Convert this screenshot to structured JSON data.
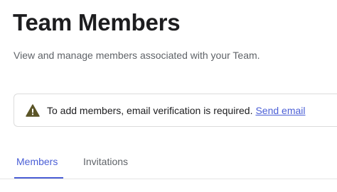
{
  "header": {
    "title": "Team Members",
    "subtitle": "View and manage members associated with your Team."
  },
  "alert": {
    "icon": "warning-icon",
    "message": "To add members, email verification is required.",
    "link_label": "Send email",
    "icon_color": "#5a5427"
  },
  "tabs": [
    {
      "label": "Members",
      "active": true
    },
    {
      "label": "Invitations",
      "active": false
    }
  ],
  "colors": {
    "accent": "#4b5fd6",
    "text": "#1d1d1f",
    "muted": "#5f6368"
  }
}
